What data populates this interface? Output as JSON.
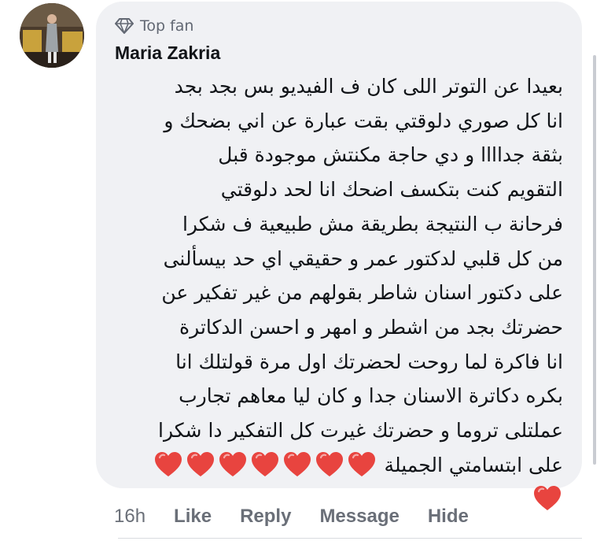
{
  "comment": {
    "badge": "Top fan",
    "badge_icon": "diamond-icon",
    "author": "Maria Zakria",
    "lines": [
      "بعيدا عن التوتر اللى كان ف الفيديو بس بجد بجد",
      "انا كل صوري دلوقتي بقت عبارة عن اني بضحك و",
      "بثقة جداااا و دي حاجة مكنتش موجودة قبل",
      "التقويم كنت بتكسف اضحك انا لحد دلوقتي",
      "فرحانة ب النتيجة بطريقة مش طبيعية ف شكرا",
      "من كل قلبي لدكتور عمر و حقيقي اي حد بيسألنى",
      "على دكتور اسنان شاطر بقولهم من غير تفكير عن",
      "حضرتك بجد من اشطر و امهر و احسن الدكاترة",
      "انا فاكرة لما روحت لحضرتك اول مرة قولتلك انا",
      "بكره دكاترة الاسنان جدا و كان ليا معاهم تجارب",
      "عملتلى تروما و حضرتك غيرت كل التفكير دا شكرا",
      "على ابتسامتي الجميلة"
    ],
    "hearts_inline": 7,
    "hearts_last_line": 1,
    "heart_color": "#e8443f"
  },
  "actions": {
    "time": "16h",
    "like": "Like",
    "reply": "Reply",
    "message": "Message",
    "hide": "Hide"
  }
}
